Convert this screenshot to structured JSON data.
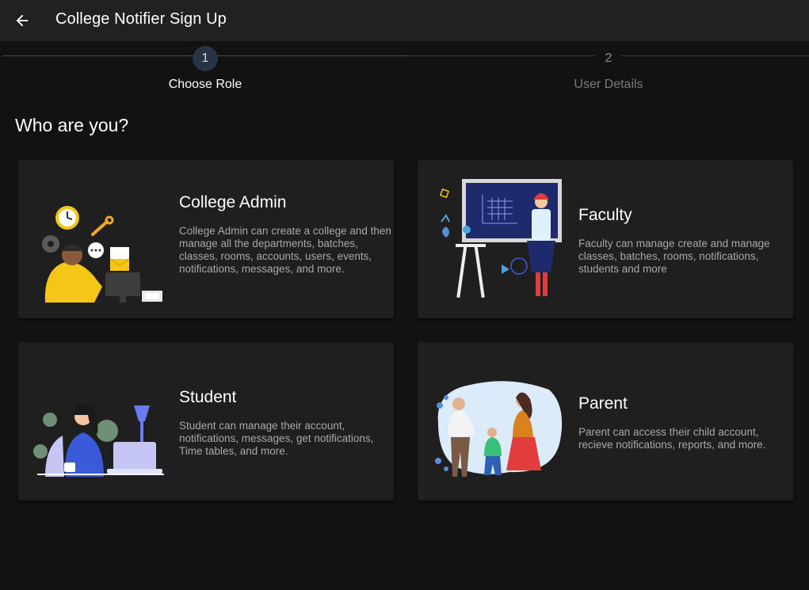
{
  "appbar": {
    "title": "College Notifier Sign Up",
    "back_icon": "arrow-left-icon"
  },
  "stepper": {
    "steps": [
      {
        "number": "1",
        "label": "Choose Role",
        "state": "active"
      },
      {
        "number": "2",
        "label": "User Details",
        "state": "inactive"
      }
    ]
  },
  "heading": "Who are you?",
  "roles": [
    {
      "title": "College Admin",
      "description": "College Admin can create a college and then manage all the departments, batches, classes, rooms, accounts, users, events, notifications, messages, and more."
    },
    {
      "title": "Faculty",
      "description": "Faculty can manage create and manage classes, batches, rooms, notifications, students and more"
    },
    {
      "title": "Student",
      "description": "Student can manage their account, notifications, messages, get notifications, Time tables, and more."
    },
    {
      "title": "Parent",
      "description": "Parent can access their child account, recieve notifications, reports, and more."
    }
  ],
  "colors": {
    "background": "#121212",
    "appbar": "#212121",
    "card": "#1f1f1f",
    "active_step": "#263445",
    "accent_yellow": "#f5c518",
    "accent_blue": "#6b7cf0"
  }
}
